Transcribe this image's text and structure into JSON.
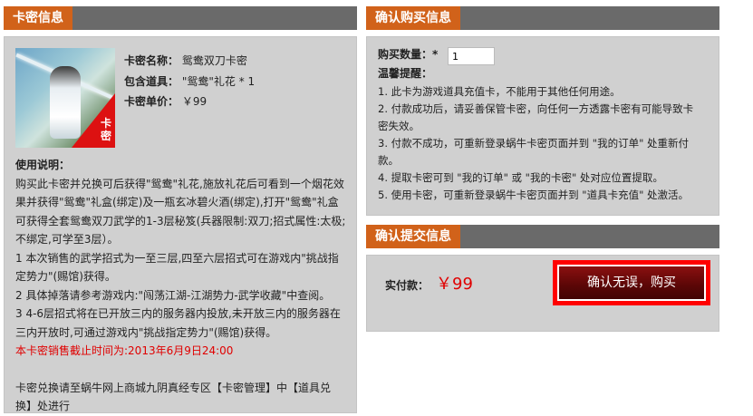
{
  "card_info": {
    "tab_title": "卡密信息",
    "name_label": "卡密名称：",
    "name_value": "鸳鸯双刀卡密",
    "items_label": "包含道具：",
    "items_value": "\"鸳鸯\"礼花 * 1",
    "price_label": "卡密单价：",
    "price_value": "￥99",
    "thumbnail_badge": "卡密",
    "usage_title": "使用说明：",
    "usage_lines": [
      "购买此卡密并兑换可后获得\"鸳鸯\"礼花,施放礼花后可看到一个烟花效",
      "果并获得\"鸳鸯\"礼盒(绑定)及一瓶玄冰碧火酒(绑定),打开\"鸳鸯\"礼盒",
      "可获得全套鸳鸯双刀武学的1-3层秘笈(兵器限制:双刀;招式属性:太极;",
      "不绑定,可学至3层）。",
      "1 本次销售的武学招式为一至三层,四至六层招式可在游戏内\"挑战指",
      "定势力\"(赐馆)获得。",
      "2 具体掉落请参考游戏内:\"闯荡江湖-江湖势力-武学收藏\"中查阅。",
      "3 4-6层招式将在已开放三内的服务器内投放,未开放三内的服务器在",
      "三内开放时,可通过游戏内\"挑战指定势力\"(赐馆)获得。"
    ],
    "deadline": "本卡密销售截止时间为:2013年6月9日24:00",
    "redeem_lines": [
      "卡密兑换请至蜗牛网上商城九阴真经专区【卡密管理】中【道具兑",
      "换】处进行"
    ]
  },
  "purchase_info": {
    "tab_title": "确认购买信息",
    "qty_label": "购买数量：*",
    "qty_value": "1",
    "tips_title": "温馨提醒：",
    "tips": [
      "1. 此卡为游戏道具充值卡，不能用于其他任何用途。",
      "2. 付款成功后，请妥善保管卡密，向任何一方透露卡密有可能导致卡",
      "密失效。",
      "3. 付款不成功，可重新登录蜗牛卡密页面并到 \"我的订单\" 处重新付",
      "款。",
      "4. 提取卡密可到 \"我的订单\" 或 \"我的卡密\" 处对应位置提取。",
      "5. 使用卡密，可重新登录蜗牛卡密页面并到 \"道具卡充值\" 处激活。"
    ]
  },
  "submit_info": {
    "tab_title": "确认提交信息",
    "pay_label": "实付款：",
    "pay_amount": "￥99",
    "buy_button": "确认无误，购买"
  },
  "colors": {
    "tab_orange": "#d1621a",
    "header_gray": "#6a6a6a",
    "panel_gray": "#d0d0d0",
    "price_red": "#e00000",
    "button_dark_red": "#5a0606",
    "button_frame_red": "#ff0000"
  }
}
